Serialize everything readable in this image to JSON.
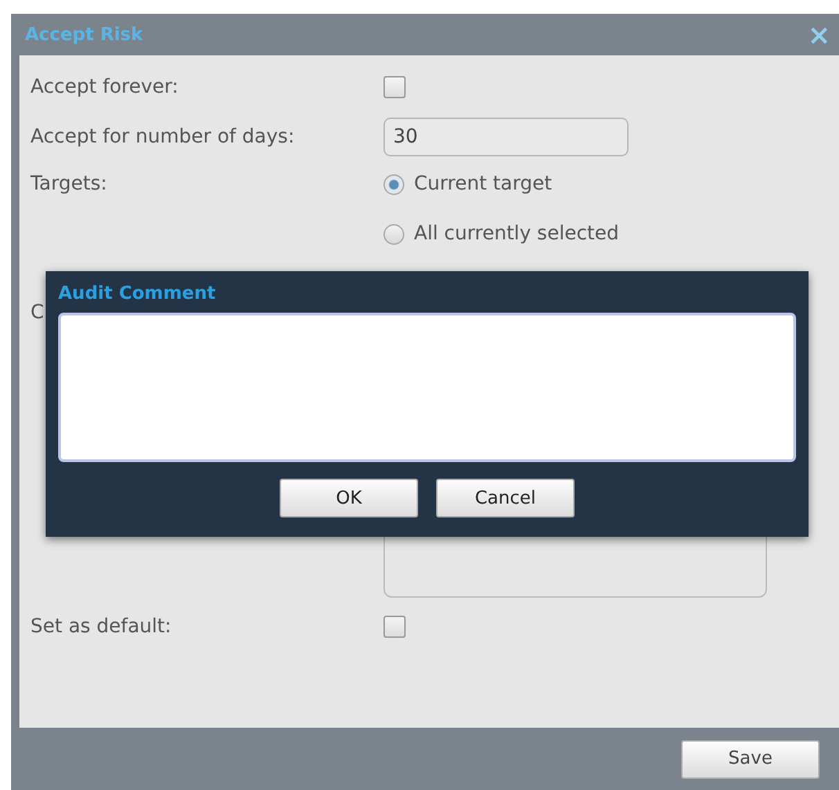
{
  "window": {
    "title": "Accept Risk",
    "close": "×"
  },
  "form": {
    "accept_forever": {
      "label": "Accept forever:",
      "checked": false
    },
    "days": {
      "label": "Accept for number of days:",
      "value": "30"
    },
    "targets": {
      "label": "Targets:",
      "options": [
        {
          "label": "Current target",
          "selected": true
        },
        {
          "label": "All currently selected",
          "selected": false
        }
      ]
    },
    "comment": {
      "label": "C"
    },
    "set_default": {
      "label": "Set as default:",
      "checked": false
    }
  },
  "audit_dialog": {
    "title": "Audit Comment",
    "buttons": [
      "OK",
      "Cancel"
    ]
  },
  "footer": {
    "buttons": [
      "Save"
    ]
  }
}
